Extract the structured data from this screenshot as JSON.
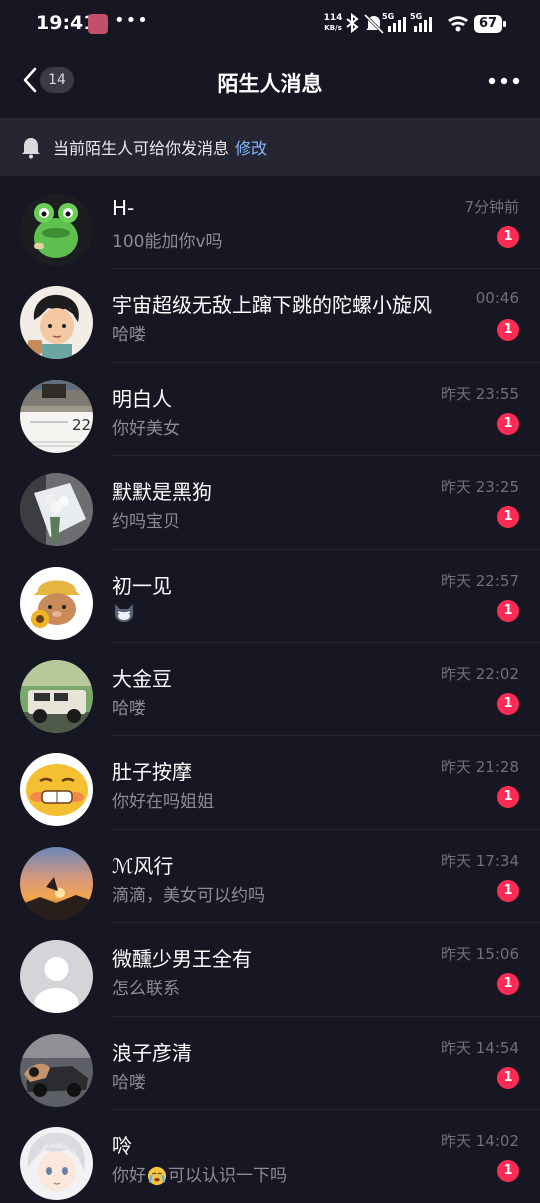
{
  "status_bar": {
    "time": "19:41",
    "net_speed_value": "114",
    "net_speed_unit": "KB/s",
    "signal_1_label": "5G",
    "signal_2_label": "5G",
    "battery": "67",
    "icons": [
      "app-notification-icon",
      "more-dots-icon",
      "bluetooth-icon",
      "mute-icon",
      "signal-icon",
      "wifi-icon",
      "battery-icon"
    ]
  },
  "header": {
    "back_count": "14",
    "title": "陌生人消息"
  },
  "notice": {
    "text": "当前陌生人可给你发消息",
    "link": "修改"
  },
  "colors": {
    "background": "#161722",
    "notice_bg": "#252631",
    "accent_link": "#7fb7ff",
    "badge_red": "#fe2c55",
    "secondary_text": "#8b8c96"
  },
  "messages": [
    {
      "name": "H-",
      "preview": "100能加你v吗",
      "time": "7分钟前",
      "unread": "1",
      "avatar": "green-frog-avatar"
    },
    {
      "name": "宇宙超级无敌上蹿下跳的陀螺小旋风",
      "preview": "哈喽",
      "time": "00:46",
      "unread": "1",
      "avatar": "cartoon-boy-avatar"
    },
    {
      "name": "明白人",
      "preview": "你好美女",
      "time": "昨天 23:55",
      "unread": "1",
      "avatar": "calendar-photo-avatar"
    },
    {
      "name": "默默是黑狗",
      "preview": "约吗宝贝",
      "time": "昨天 23:25",
      "unread": "1",
      "avatar": "flower-bouquet-avatar"
    },
    {
      "name": "初一见",
      "preview": "",
      "time": "昨天 22:57",
      "unread": "1",
      "avatar": "bear-sunflower-avatar",
      "preview_icon": "cat-face-emoji"
    },
    {
      "name": "大金豆",
      "preview": "哈喽",
      "time": "昨天 22:02",
      "unread": "1",
      "avatar": "jeep-car-avatar"
    },
    {
      "name": "肚子按摩",
      "preview": "你好在吗姐姐",
      "time": "昨天 21:28",
      "unread": "1",
      "avatar": "grin-emoji-avatar"
    },
    {
      "name": "ℳ风行",
      "preview": "滴滴，美女可以约吗",
      "time": "昨天 17:34",
      "unread": "1",
      "avatar": "sunset-sky-avatar"
    },
    {
      "name": "微醺少男王全有",
      "preview": "怎么联系",
      "time": "昨天 15:06",
      "unread": "1",
      "avatar": "default-user-avatar"
    },
    {
      "name": "浪子彦清",
      "preview": "哈喽",
      "time": "昨天 14:54",
      "unread": "1",
      "avatar": "sports-car-avatar"
    },
    {
      "name": "唥",
      "preview_before": "你好",
      "preview_after": "可以认识一下吗",
      "time": "昨天 14:02",
      "unread": "1",
      "avatar": "anime-boy-avatar",
      "preview_icon": "crying-face-emoji"
    }
  ]
}
